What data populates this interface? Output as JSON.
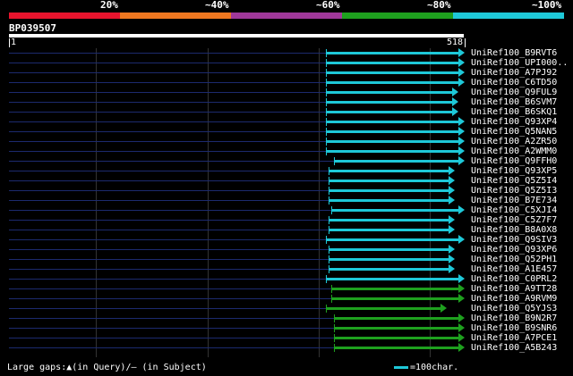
{
  "identity_legend": [
    {
      "label": "20%",
      "color": "#e8142d"
    },
    {
      "label": "~40%",
      "color": "#f07820"
    },
    {
      "label": "~60%",
      "color": "#a0389a"
    },
    {
      "label": "~80%",
      "color": "#1ea01e"
    },
    {
      "label": "~100%",
      "color": "#1ec8d8"
    }
  ],
  "query": {
    "name": "BP039507",
    "start": "1",
    "end": "518",
    "length": 518
  },
  "hits": [
    {
      "name": "UniRef100_B9RVT6",
      "start": 361,
      "end": 518,
      "color": "#1ec8d8"
    },
    {
      "name": "UniRef100_UPI000..",
      "start": 361,
      "end": 518,
      "color": "#1ec8d8"
    },
    {
      "name": "UniRef100_A7PJ92",
      "start": 361,
      "end": 518,
      "color": "#1ec8d8"
    },
    {
      "name": "UniRef100_C6TD50",
      "start": 361,
      "end": 518,
      "color": "#1ec8d8"
    },
    {
      "name": "UniRef100_Q9FUL9",
      "start": 361,
      "end": 511,
      "color": "#1ec8d8"
    },
    {
      "name": "UniRef100_B6SVM7",
      "start": 361,
      "end": 511,
      "color": "#1ec8d8"
    },
    {
      "name": "UniRef100_B6SKQ1",
      "start": 361,
      "end": 511,
      "color": "#1ec8d8"
    },
    {
      "name": "UniRef100_Q93XP4",
      "start": 361,
      "end": 518,
      "color": "#1ec8d8"
    },
    {
      "name": "UniRef100_Q5NAN5",
      "start": 361,
      "end": 518,
      "color": "#1ec8d8"
    },
    {
      "name": "UniRef100_A2ZR50",
      "start": 361,
      "end": 518,
      "color": "#1ec8d8"
    },
    {
      "name": "UniRef100_A2WMM0",
      "start": 361,
      "end": 518,
      "color": "#1ec8d8"
    },
    {
      "name": "UniRef100_Q9FFH0",
      "start": 370,
      "end": 518,
      "color": "#1ec8d8"
    },
    {
      "name": "UniRef100_Q93XP5",
      "start": 364,
      "end": 507,
      "color": "#1ec8d8"
    },
    {
      "name": "UniRef100_Q5Z5I4",
      "start": 364,
      "end": 507,
      "color": "#1ec8d8"
    },
    {
      "name": "UniRef100_Q5Z5I3",
      "start": 364,
      "end": 507,
      "color": "#1ec8d8"
    },
    {
      "name": "UniRef100_B7E734",
      "start": 364,
      "end": 507,
      "color": "#1ec8d8"
    },
    {
      "name": "UniRef100_C5XJI4",
      "start": 367,
      "end": 518,
      "color": "#1ec8d8"
    },
    {
      "name": "UniRef100_C5Z7F7",
      "start": 364,
      "end": 507,
      "color": "#1ec8d8"
    },
    {
      "name": "UniRef100_B8A0X8",
      "start": 364,
      "end": 507,
      "color": "#1ec8d8"
    },
    {
      "name": "UniRef100_Q9SIV3",
      "start": 361,
      "end": 518,
      "color": "#1ec8d8"
    },
    {
      "name": "UniRef100_Q93XP6",
      "start": 364,
      "end": 507,
      "color": "#1ec8d8"
    },
    {
      "name": "UniRef100_Q52PH1",
      "start": 364,
      "end": 507,
      "color": "#1ec8d8"
    },
    {
      "name": "UniRef100_A1E457",
      "start": 364,
      "end": 507,
      "color": "#1ec8d8"
    },
    {
      "name": "UniRef100_C0PRL2",
      "start": 361,
      "end": 518,
      "color": "#1ec8d8"
    },
    {
      "name": "UniRef100_A9TT28",
      "start": 367,
      "end": 518,
      "color": "#1ea01e"
    },
    {
      "name": "UniRef100_A9RVM9",
      "start": 367,
      "end": 518,
      "color": "#1ea01e"
    },
    {
      "name": "UniRef100_Q5YJS3",
      "start": 361,
      "end": 498,
      "color": "#1ea01e"
    },
    {
      "name": "UniRef100_B9N2R7",
      "start": 370,
      "end": 518,
      "color": "#1ea01e"
    },
    {
      "name": "UniRef100_B9SNR6",
      "start": 370,
      "end": 518,
      "color": "#1ea01e"
    },
    {
      "name": "UniRef100_A7PCE1",
      "start": 370,
      "end": 518,
      "color": "#1ea01e"
    },
    {
      "name": "UniRef100_A5B243",
      "start": 370,
      "end": 518,
      "color": "#1ea01e"
    }
  ],
  "footer": {
    "text": "Large gaps:▲(in Query)/– (in Subject)",
    "key_text": "=100char."
  }
}
